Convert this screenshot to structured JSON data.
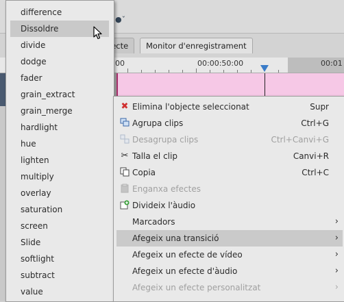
{
  "app": {
    "tabs": [
      {
        "label": "jecte"
      },
      {
        "label": "Monitor d'enregistrament"
      }
    ],
    "timecodes": [
      "00",
      "00:00:50:00",
      "00:01"
    ]
  },
  "transition_list": {
    "items": [
      {
        "label": "difference"
      },
      {
        "label": "Dissoldre",
        "highlighted": true
      },
      {
        "label": "divide"
      },
      {
        "label": "dodge"
      },
      {
        "label": "fader"
      },
      {
        "label": "grain_extract"
      },
      {
        "label": "grain_merge"
      },
      {
        "label": "hardlight"
      },
      {
        "label": "hue"
      },
      {
        "label": "lighten"
      },
      {
        "label": "multiply"
      },
      {
        "label": "overlay"
      },
      {
        "label": "saturation"
      },
      {
        "label": "screen"
      },
      {
        "label": "Slide"
      },
      {
        "label": "softlight"
      },
      {
        "label": "subtract"
      },
      {
        "label": "value"
      }
    ]
  },
  "context_menu": {
    "items": [
      {
        "label": "Elimina l'objecte seleccionat",
        "shortcut": "Supr",
        "icon": "delete-icon",
        "enabled": true
      },
      {
        "label": "Agrupa clips",
        "shortcut": "Ctrl+G",
        "icon": "group-icon",
        "enabled": true
      },
      {
        "label": "Desagrupa clips",
        "shortcut": "Ctrl+Canvi+G",
        "icon": "ungroup-icon",
        "enabled": false
      },
      {
        "label": "Talla el clip",
        "shortcut": "Canvi+R",
        "icon": "scissors-icon",
        "enabled": true
      },
      {
        "label": "Copia",
        "shortcut": "Ctrl+C",
        "icon": "copy-icon",
        "enabled": true
      },
      {
        "label": "Enganxa efectes",
        "shortcut": "",
        "icon": "paste-icon",
        "enabled": false
      },
      {
        "label": "Divideix l'àudio",
        "shortcut": "",
        "icon": "split-audio-icon",
        "enabled": true
      },
      {
        "label": "Marcadors",
        "shortcut": "",
        "icon": "",
        "enabled": true,
        "submenu": true
      },
      {
        "label": "Afegeix una transició",
        "shortcut": "",
        "icon": "",
        "enabled": true,
        "submenu": true,
        "highlighted": true
      },
      {
        "label": "Afegeix un efecte de vídeo",
        "shortcut": "",
        "icon": "",
        "enabled": true,
        "submenu": true
      },
      {
        "label": "Afegeix un efecte d'àudio",
        "shortcut": "",
        "icon": "",
        "enabled": true,
        "submenu": true
      },
      {
        "label": "Afegeix un efecte personalitzat",
        "shortcut": "",
        "icon": "",
        "enabled": false,
        "submenu": true
      }
    ]
  },
  "colors": {
    "clip": "#f6c8e6",
    "menu_bg": "#e9e9e9",
    "highlight": "#c9c9c9",
    "playhead": "#3a7cc8",
    "delete_red": "#d03030"
  }
}
